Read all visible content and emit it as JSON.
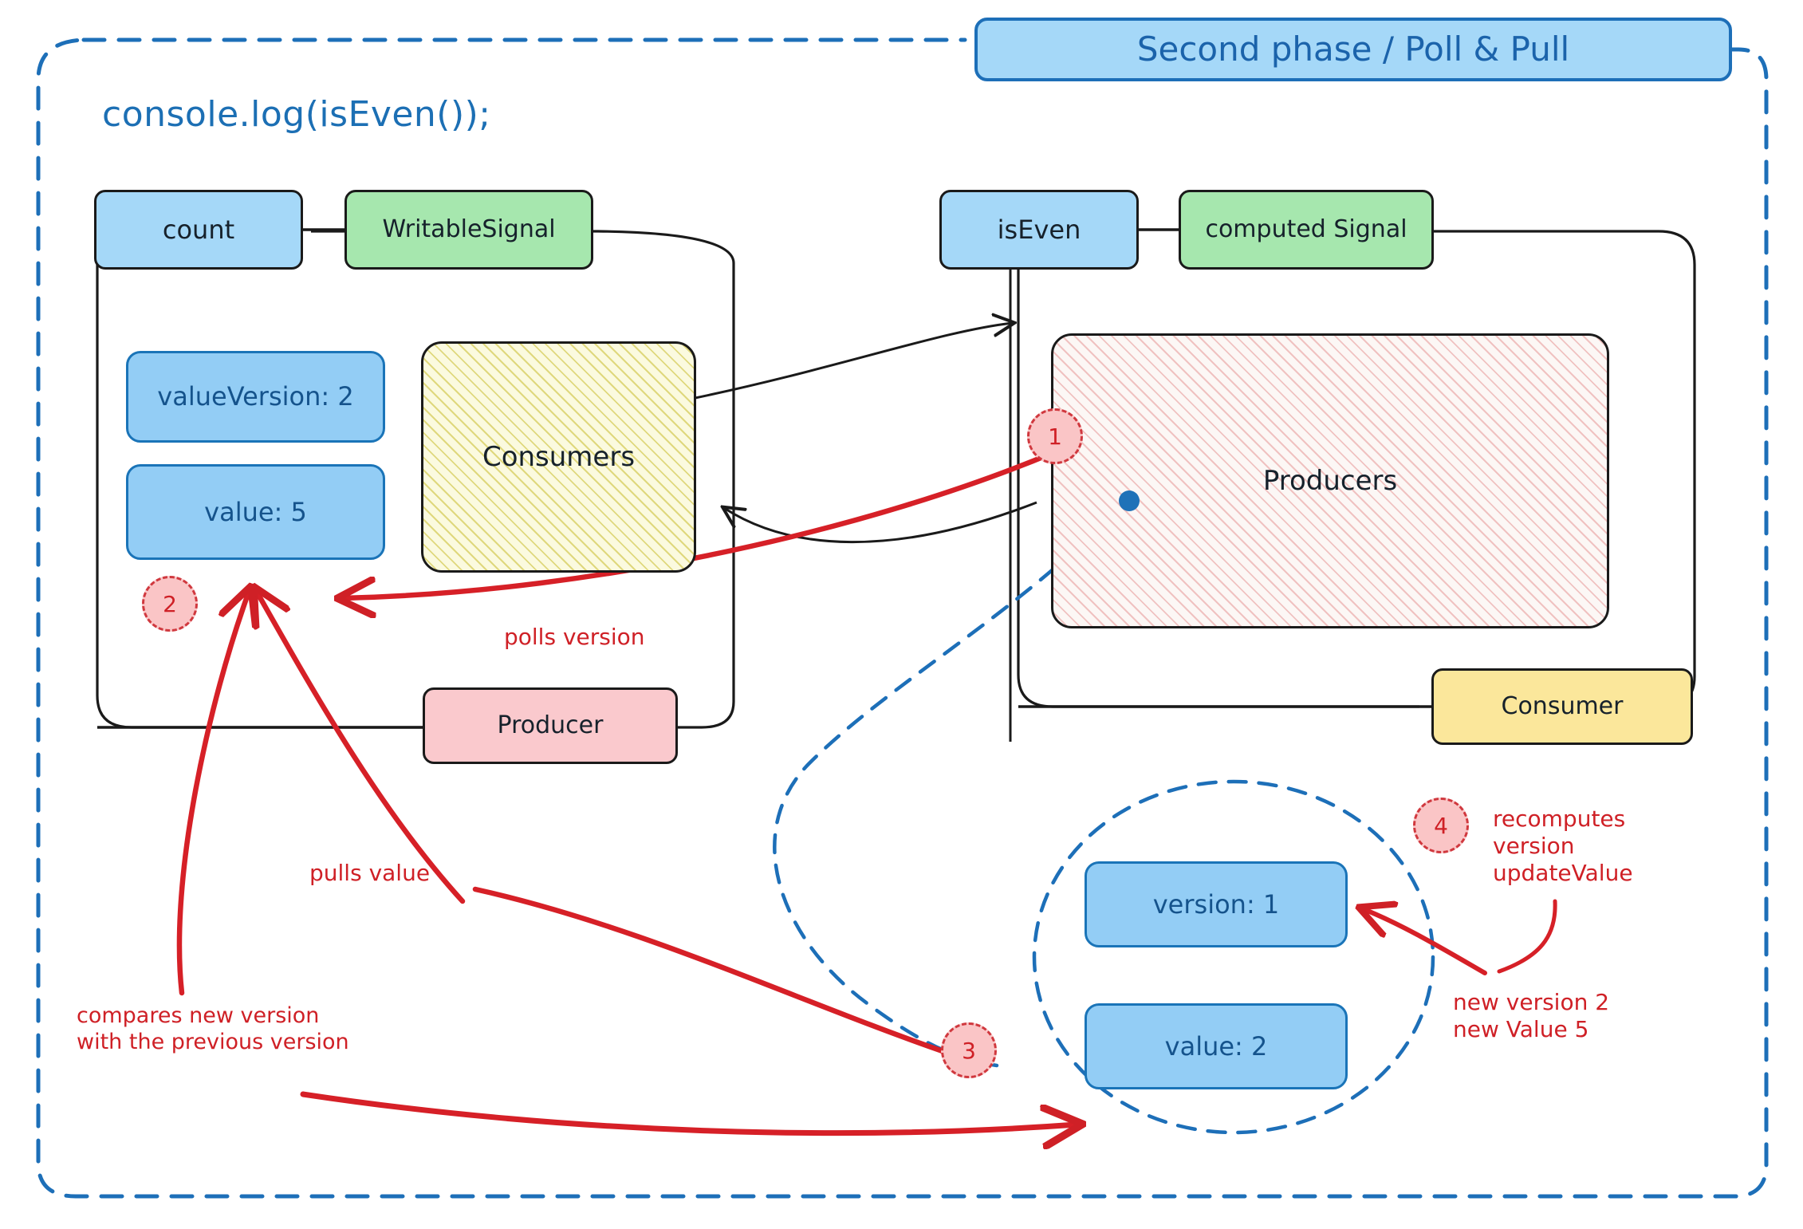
{
  "diagram": {
    "title_badge": "Second phase / Poll & Pull",
    "code_label": "console.log(isEven());"
  },
  "left_signal": {
    "name": "count",
    "kind": "WritableSignal",
    "fields": [
      "valueVersion: 2",
      "value: 5"
    ],
    "consumers_label": "Consumers",
    "role_label": "Producer"
  },
  "right_signal": {
    "name": "isEven",
    "kind": "computed Signal",
    "producers_label": "Producers",
    "role_label": "Consumer"
  },
  "computed_state": {
    "fields": [
      "version: 1",
      "value: 2"
    ]
  },
  "markers": {
    "one": "1",
    "two": "2",
    "three": "3",
    "four": "4"
  },
  "annotations": {
    "polls_version": "polls version",
    "pulls_value": "pulls value",
    "compares": "compares new version\nwith the previous version",
    "recomputes": "recomputes\nversion\nupdateValue",
    "new_values": "new version 2\nnew Value 5"
  },
  "colors": {
    "blue_fill": "#a5d8f8",
    "green_fill": "#a6e7ae",
    "pink_fill": "#fac9cd",
    "yellow_fill": "#fbe79b",
    "red_accent": "#cf2026",
    "blue_accent": "#1c6fb4",
    "stroke": "#1a1a1a"
  }
}
